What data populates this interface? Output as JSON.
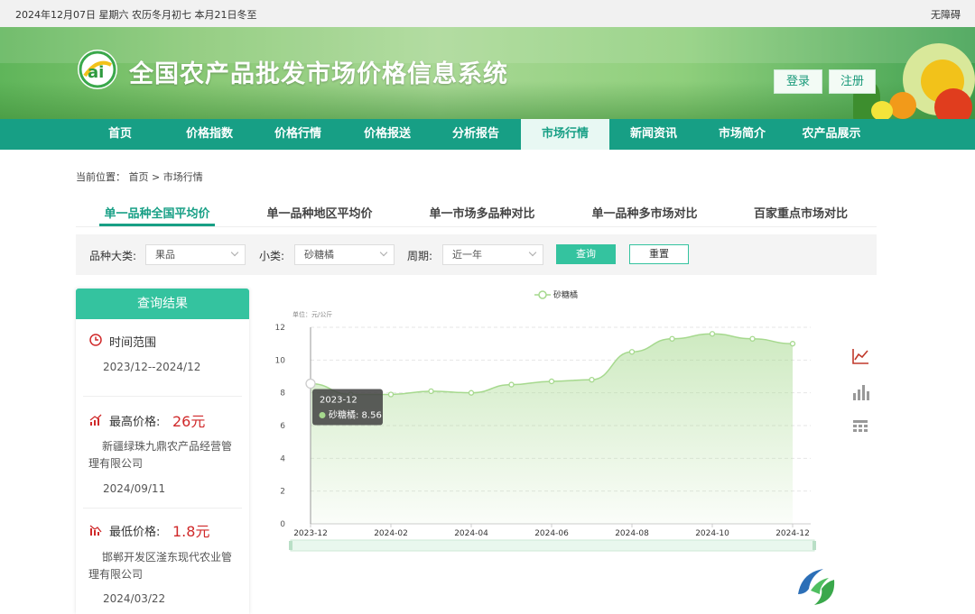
{
  "topbar": {
    "date_text": "2024年12月07日 星期六 农历冬月初七 本月21日冬至",
    "accessibility": "无障碍"
  },
  "header": {
    "site_title": "全国农产品批发市场价格信息系统",
    "login": "登录",
    "register": "注册"
  },
  "nav": {
    "items": [
      "首页",
      "价格指数",
      "价格行情",
      "价格报送",
      "分析报告",
      "市场行情",
      "新闻资讯",
      "市场简介",
      "农产品展示"
    ],
    "active_index": 5
  },
  "breadcrumb": {
    "prefix": "当前位置：",
    "home": "首页",
    "sep": ">",
    "current": "市场行情"
  },
  "tabs": {
    "items": [
      "单一品种全国平均价",
      "单一品种地区平均价",
      "单一市场多品种对比",
      "单一品种多市场对比",
      "百家重点市场对比"
    ],
    "active_index": 0
  },
  "filter": {
    "category_label": "品种大类:",
    "category_value": "果品",
    "subcategory_label": "小类:",
    "subcategory_value": "砂糖橘",
    "period_label": "周期:",
    "period_value": "近一年",
    "query": "查询",
    "reset": "重置"
  },
  "result": {
    "title": "查询结果",
    "time_range_label": "时间范围",
    "time_range_value": "2023/12--2024/12",
    "max_label": "最高价格:",
    "max_value": "26元",
    "max_market": "新疆绿珠九鼎农产品经营管理有限公司",
    "max_date": "2024/09/11",
    "min_label": "最低价格:",
    "min_value": "1.8元",
    "min_market": "邯郸开发区滏东现代农业管理有限公司",
    "min_date": "2024/03/22"
  },
  "colors": {
    "primary": "#179f85",
    "accent": "#34c39f",
    "price_red": "#d0292a",
    "series": "#a6d98e"
  },
  "chart_data": {
    "type": "area",
    "unit_label": "单位：元/公斤",
    "legend": [
      "砂糖橘"
    ],
    "legend_position": "top-center",
    "x": [
      "2023-12",
      "2024-01",
      "2024-02",
      "2024-03",
      "2024-04",
      "2024-05",
      "2024-06",
      "2024-07",
      "2024-08",
      "2024-09",
      "2024-10",
      "2024-11",
      "2024-12"
    ],
    "x_tick_labels": [
      "2023-12",
      "2024-02",
      "2024-04",
      "2024-06",
      "2024-08",
      "2024-10",
      "2024-12"
    ],
    "series": [
      {
        "name": "砂糖橘",
        "values": [
          8.56,
          7.9,
          7.9,
          8.1,
          8.0,
          8.5,
          8.7,
          8.8,
          10.5,
          11.3,
          11.6,
          11.3,
          11.0
        ]
      }
    ],
    "ylim": [
      0,
      12
    ],
    "y_ticks": [
      0,
      2,
      4,
      6,
      8,
      10,
      12
    ],
    "grid": true,
    "tooltip": {
      "title": "2023-12",
      "series": "砂糖橘",
      "value": "8.56"
    }
  }
}
